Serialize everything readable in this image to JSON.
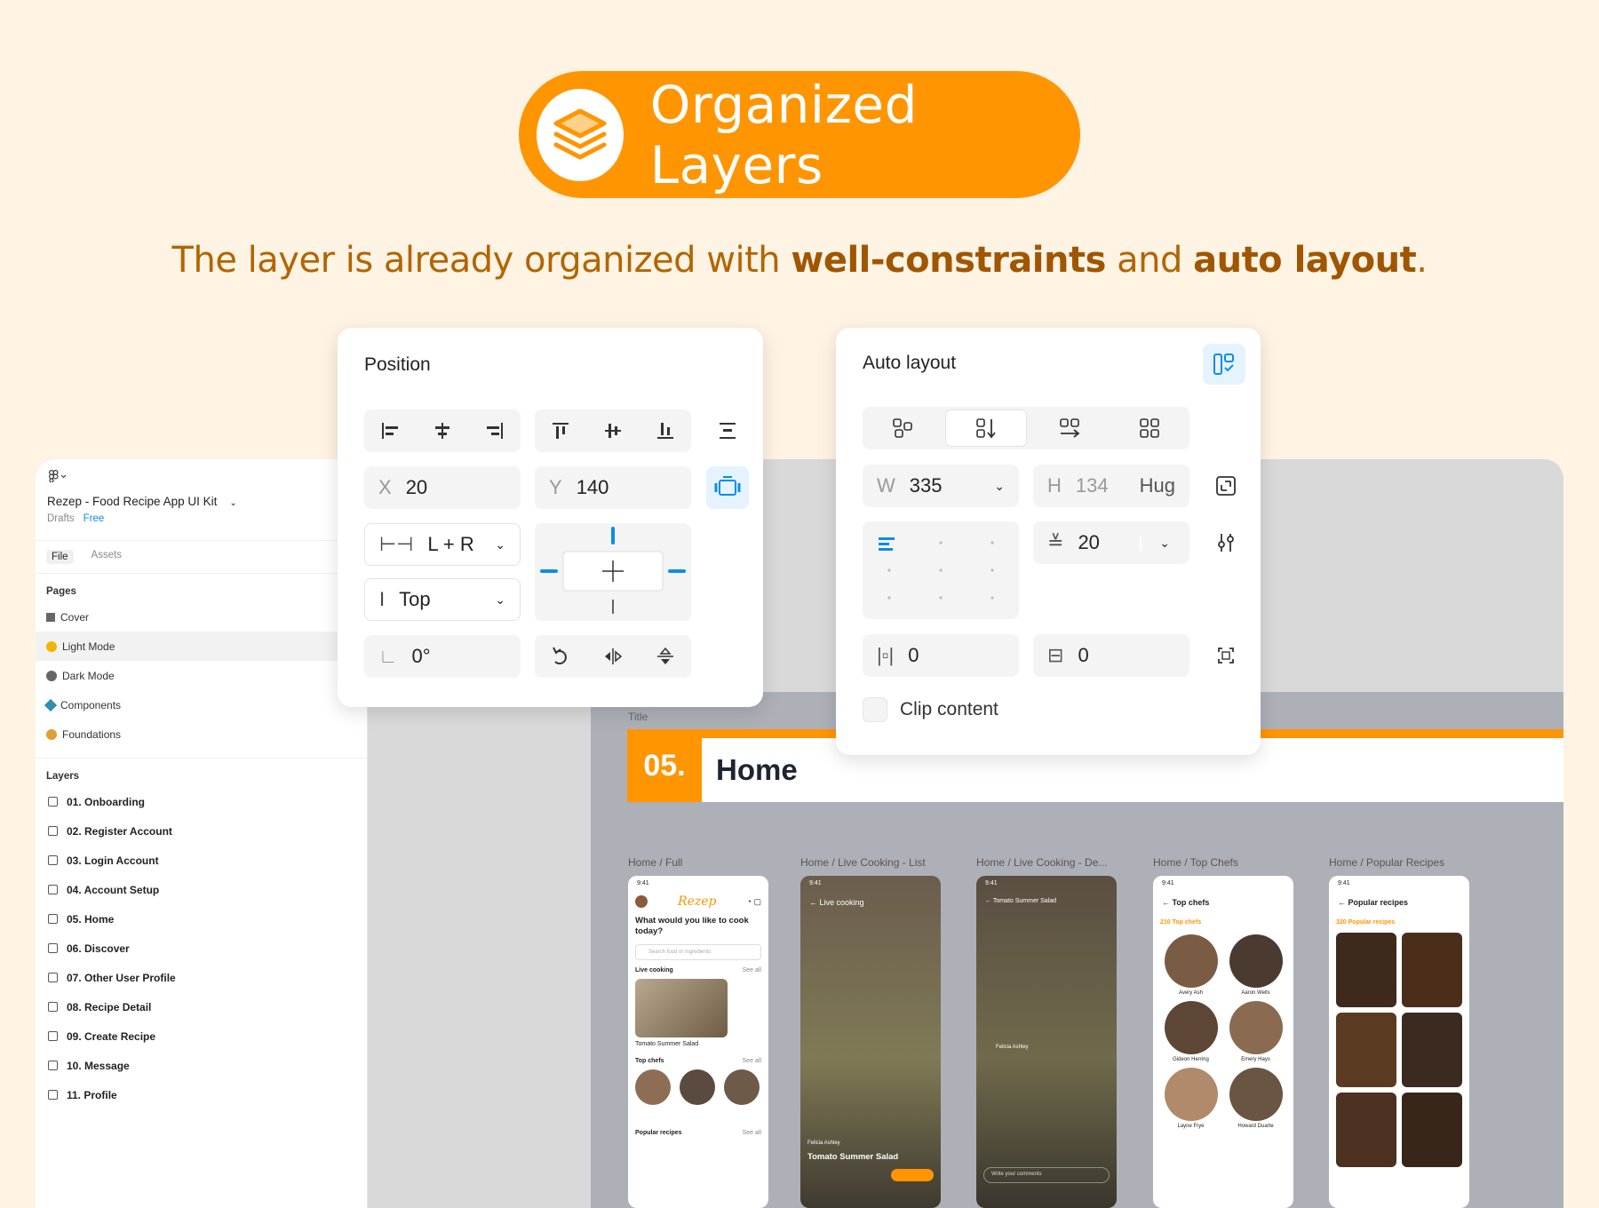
{
  "header": {
    "title": "Organized Layers",
    "subtitle_pre": "The layer is already organized with ",
    "subtitle_bold1": "well-constraints",
    "subtitle_mid": " and ",
    "subtitle_bold2": "auto layout",
    "subtitle_end": "."
  },
  "colors": {
    "accent": "#FF9500",
    "background": "#FFF3E4",
    "link": "#0D8CE9"
  },
  "sidebar": {
    "file_name": "Rezep - Food Recipe App UI Kit",
    "drafts": "Drafts",
    "plan": "Free",
    "tabs": [
      "File",
      "Assets"
    ],
    "pages_title": "Pages",
    "pages": [
      "Cover",
      "Light Mode",
      "Dark Mode",
      "Components",
      "Foundations"
    ],
    "layers_title": "Layers",
    "layers": [
      "01. Onboarding",
      "02. Register Account",
      "03. Login Account",
      "04. Account Setup",
      "05. Home",
      "06. Discover",
      "07. Other User Profile",
      "08. Recipe Detail",
      "09. Create Recipe",
      "10. Message",
      "11. Profile"
    ]
  },
  "position_panel": {
    "title": "Position",
    "x_label": "X",
    "x_value": "20",
    "y_label": "Y",
    "y_value": "140",
    "h_constraint": "L + R",
    "v_constraint": "Top",
    "rotation": "0°"
  },
  "auto_layout_panel": {
    "title": "Auto layout",
    "w_label": "W",
    "w_value": "335",
    "h_label": "H",
    "h_value": "134",
    "h_mode": "Hug",
    "gap": "20",
    "padding_h": "0",
    "padding_v": "0",
    "clip_content": "Clip content"
  },
  "canvas": {
    "title_label": "Title",
    "section_number": "05.",
    "section_title": "Home",
    "frames": [
      "Home / Full",
      "Home / Live Cooking - List",
      "Home / Live Cooking - De...",
      "Home / Top Chefs",
      "Home / Popular Recipes"
    ]
  },
  "phones": {
    "time": "9:41",
    "full": {
      "brand": "Rezep",
      "question": "What would you like to cook today?",
      "search": "Search food or ingredients",
      "live": "Live cooking",
      "see_all": "See all",
      "recipe": "Tomato Summer Salad",
      "top_chefs": "Top chefs",
      "popular": "Popular recipes"
    },
    "live_list": {
      "title": "Live cooking",
      "chef": "Felicia Ashley",
      "dish": "Tomato Summer Salad"
    },
    "live_detail": {
      "title": "Tomato Summer Salad",
      "chef": "Felicia Ashley",
      "comment_hint": "Write your comments"
    },
    "top_chefs": {
      "title": "Top chefs",
      "count": "210 Top chefs",
      "chefs": [
        "Avery Ash",
        "Aaron Wells",
        "Gideon Herring",
        "Emery Hays",
        "Layne Frye",
        "Howard Duarte"
      ]
    },
    "popular": {
      "title": "Popular recipes",
      "count": "320 Popular recipes"
    }
  }
}
